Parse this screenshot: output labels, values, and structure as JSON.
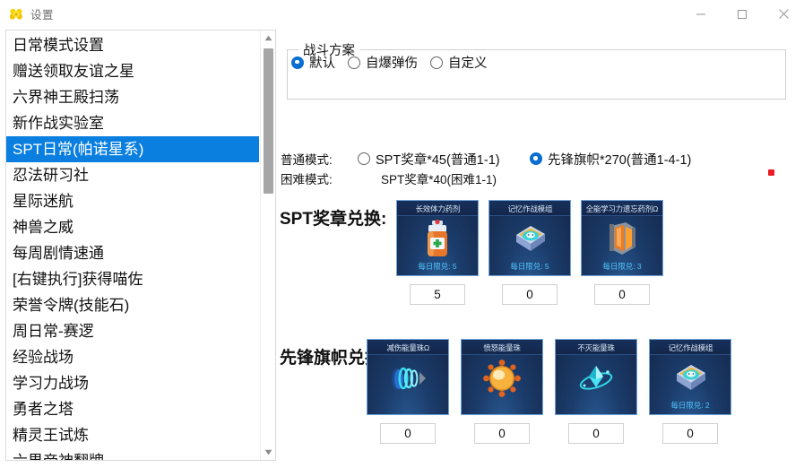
{
  "window": {
    "title": "设置",
    "icon": "flower-icon",
    "controls": [
      {
        "name": "minimize-button",
        "glyph": "minimize-icon"
      },
      {
        "name": "maximize-button",
        "glyph": "maximize-icon"
      },
      {
        "name": "close-button",
        "glyph": "close-icon"
      }
    ]
  },
  "accent_color": "#0a7fe0",
  "alert_dot_color": "#ec1c24",
  "sidebar": {
    "items": [
      {
        "label": "日常模式设置",
        "selected": false,
        "dot": false
      },
      {
        "label": "赠送领取友谊之星",
        "selected": false,
        "dot": false
      },
      {
        "label": "六界神王殿扫荡",
        "selected": false,
        "dot": false
      },
      {
        "label": "新作战实验室",
        "selected": false,
        "dot": false
      },
      {
        "label": "SPT日常(帕诺星系)",
        "selected": true,
        "dot": false
      },
      {
        "label": "忍法研习社",
        "selected": false,
        "dot": false
      },
      {
        "label": "星际迷航",
        "selected": false,
        "dot": false
      },
      {
        "label": "神兽之威",
        "selected": false,
        "dot": true
      },
      {
        "label": "每周剧情速通",
        "selected": false,
        "dot": false
      },
      {
        "label": "[右键执行]获得喵佐",
        "selected": false,
        "dot": false
      },
      {
        "label": "荣誉令牌(技能石)",
        "selected": false,
        "dot": false
      },
      {
        "label": "周日常-赛逻",
        "selected": false,
        "dot": false
      },
      {
        "label": "经验战场",
        "selected": false,
        "dot": false
      },
      {
        "label": "学习力战场",
        "selected": false,
        "dot": false
      },
      {
        "label": "勇者之塔",
        "selected": false,
        "dot": false
      },
      {
        "label": "精灵王试炼",
        "selected": false,
        "dot": false
      },
      {
        "label": "六界帝神翻牌",
        "selected": false,
        "dot": false
      }
    ],
    "scrollbar": {
      "up_arrow": "chevron-up-icon",
      "down_arrow": "chevron-down-icon"
    }
  },
  "battle_plan": {
    "legend": "战斗方案",
    "options": [
      {
        "label": "默认",
        "selected": true
      },
      {
        "label": "自爆弹伤",
        "selected": false
      },
      {
        "label": "自定义",
        "selected": false
      }
    ]
  },
  "modes": {
    "normal": {
      "label": "普通模式:",
      "options": [
        {
          "label": "SPT奖章*45(普通1-1)",
          "selected": false
        },
        {
          "label": "先锋旗帜*270(普通1-4-1)",
          "selected": true
        }
      ]
    },
    "hard": {
      "label": "困难模式:",
      "text": "SPT奖章*40(困难1-1)"
    }
  },
  "spt_exchange": {
    "title": "SPT奖章兑换:",
    "cards": [
      {
        "name": "长效体力药剂",
        "limit": "每日限兑: 5",
        "art": "potion-bottle-icon",
        "qty": "5"
      },
      {
        "name": "记忆作战模组",
        "limit": "每日限兑: 5",
        "art": "memory-module-icon",
        "qty": "0"
      },
      {
        "name": "全能学习力遗忘药剂Ω",
        "limit": "每日限兑: 3",
        "art": "orange-canister-icon",
        "qty": "0"
      }
    ]
  },
  "flag_exchange": {
    "title": "先锋旗帜兑换:",
    "cards": [
      {
        "name": "减伤能量珠Ω",
        "limit": "",
        "art": "blue-spiral-bead-icon",
        "qty": "0"
      },
      {
        "name": "愤怒能量珠",
        "limit": "",
        "art": "orange-orb-icon",
        "qty": "0"
      },
      {
        "name": "不灭能量珠",
        "limit": "",
        "art": "cyan-crystal-icon",
        "qty": "0"
      },
      {
        "name": "记忆作战模组",
        "limit": "每日限兑: 2",
        "art": "memory-module-icon",
        "qty": "0"
      }
    ]
  }
}
